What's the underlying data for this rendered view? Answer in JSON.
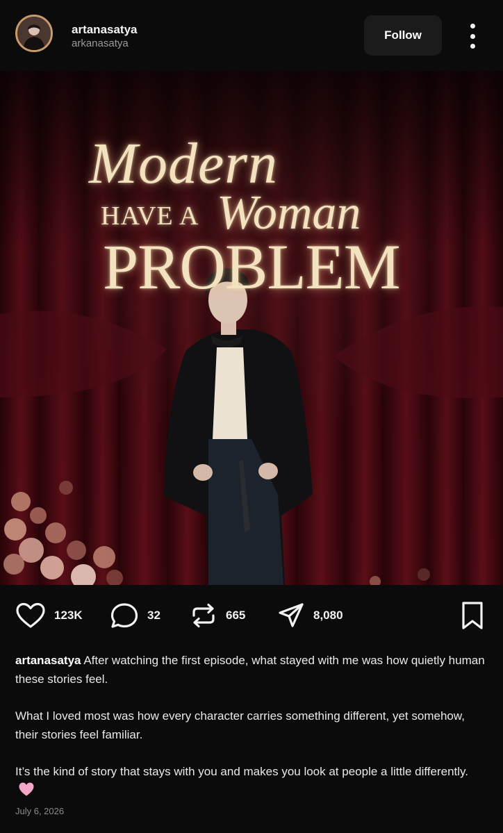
{
  "header": {
    "username": "artanasatya",
    "handle": "arkanasatya",
    "follow_label": "Follow",
    "more_icon": "more-vertical-icon"
  },
  "post_image": {
    "title_line1": "Modern",
    "title_line2a": "HAVE A",
    "title_line2b": "Woman",
    "title_line3": "PROBLEM"
  },
  "actions": {
    "likes": "123K",
    "comments": "32",
    "reposts": "665",
    "shares": "8,080",
    "icons": [
      "heart-icon",
      "comment-icon",
      "repost-icon",
      "send-icon",
      "bookmark-icon"
    ]
  },
  "caption": {
    "username": "artanasatya",
    "para1": "After watching the first episode, what stayed with me was how quietly human these stories feel.",
    "para2": "What I loved most was how every character carries something different, yet somehow, their stories feel familiar.",
    "para3": "It’s the kind of story that stays with you and makes you look at people a little differently.",
    "emoji": "pink-heart"
  },
  "date": "July 6, 2026",
  "colors": {
    "background": "#0b0b0b",
    "follow_bg": "#1b1b1b",
    "poster_gold": "#f3e2bf",
    "curtain": "#4a0a12",
    "avatar_ring": "#c89b6a"
  }
}
